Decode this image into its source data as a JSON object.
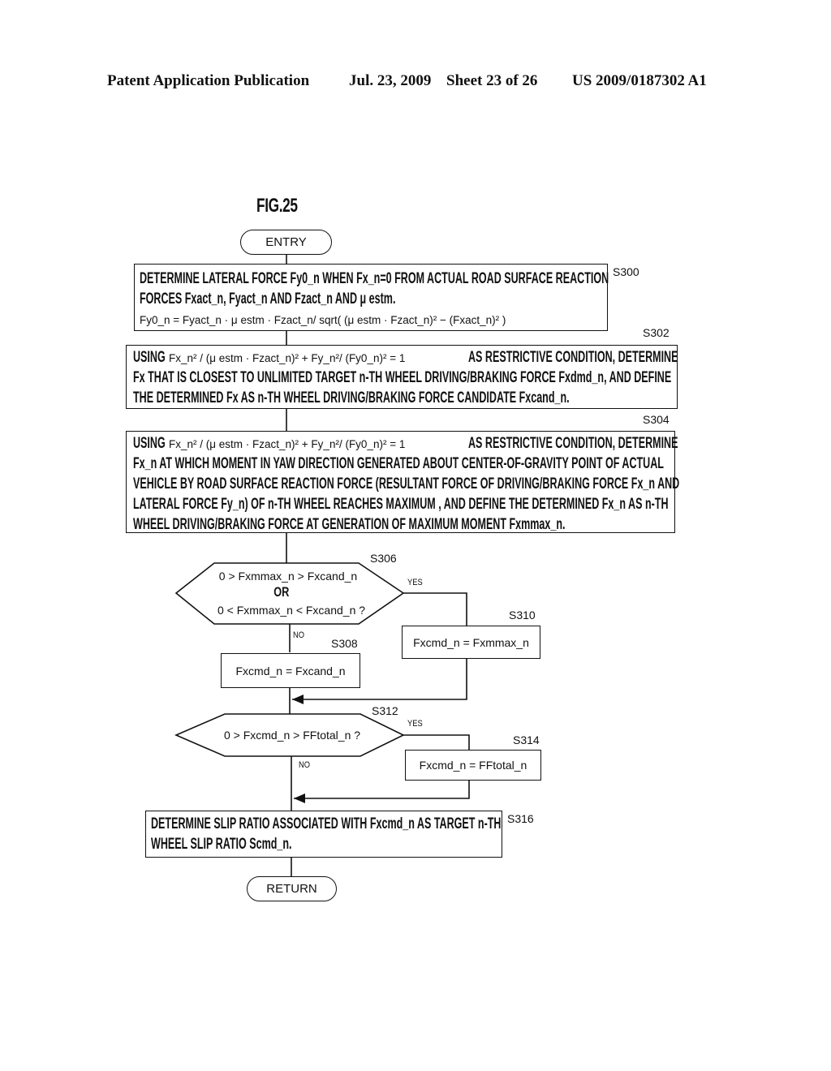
{
  "header": {
    "left": "Patent Application Publication",
    "date": "Jul. 23, 2009",
    "sheet": "Sheet 23 of 26",
    "pub_number": "US 2009/0187302 A1"
  },
  "figure": {
    "title": "FIG.25",
    "entry": "ENTRY",
    "return": "RETURN",
    "steps": {
      "s300": {
        "id": "S300",
        "line1": "DETERMINE LATERAL FORCE Fy0_n WHEN Fx_n=0 FROM ACTUAL ROAD SURFACE REACTION",
        "line2": "FORCES Fxact_n, Fyact_n AND Fzact_n AND μ estm.",
        "formula": "Fy0_n = Fyact_n · μ estm · Fzact_n/ sqrt( (μ estm ·  Fzact_n)² − (Fxact_n)² )"
      },
      "s302": {
        "id": "S302",
        "using": "USING",
        "formula": "Fx_n²  / (μ estm · Fzact_n)² + Fy_n²/ (Fy0_n)² = 1",
        "line1_rest": "AS RESTRICTIVE CONDITION, DETERMINE",
        "line2": "Fx THAT IS CLOSEST TO UNLIMITED TARGET n-TH WHEEL DRIVING/BRAKING FORCE Fxdmd_n, AND DEFINE",
        "line3": "THE DETERMINED Fx AS n-TH WHEEL DRIVING/BRAKING FORCE CANDIDATE Fxcand_n."
      },
      "s304": {
        "id": "S304",
        "using": "USING",
        "formula": "Fx_n²  / (μ estm · Fzact_n)² + Fy_n²/ (Fy0_n)² = 1",
        "line1_rest": "AS RESTRICTIVE CONDITION, DETERMINE",
        "line2": "Fx_n AT WHICH MOMENT IN YAW DIRECTION GENERATED ABOUT CENTER-OF-GRAVITY POINT OF ACTUAL",
        "line3": "VEHICLE BY ROAD SURFACE REACTION FORCE (RESULTANT FORCE OF DRIVING/BRAKING FORCE Fx_n AND",
        "line4": "LATERAL FORCE Fy_n) OF n-TH WHEEL REACHES MAXIMUM , AND DEFINE THE DETERMINED Fx_n AS n-TH",
        "line5": "WHEEL DRIVING/BRAKING FORCE AT GENERATION OF MAXIMUM MOMENT Fxmmax_n."
      },
      "s306": {
        "id": "S306",
        "line1": "0 > Fxmmax_n > Fxcand_n",
        "or": "OR",
        "line2": "0 < Fxmmax_n < Fxcand_n ?",
        "yes": "YES",
        "no": "NO"
      },
      "s308": {
        "id": "S308",
        "text": "Fxcmd_n = Fxcand_n"
      },
      "s310": {
        "id": "S310",
        "text": "Fxcmd_n = Fxmmax_n"
      },
      "s312": {
        "id": "S312",
        "text": "0 > Fxcmd_n > FFtotal_n ?",
        "yes": "YES",
        "no": "NO"
      },
      "s314": {
        "id": "S314",
        "text": "Fxcmd_n = FFtotal_n"
      },
      "s316": {
        "id": "S316",
        "line1": "DETERMINE SLIP RATIO ASSOCIATED WITH Fxcmd_n AS TARGET n-TH",
        "line2": "WHEEL SLIP RATIO Scmd_n."
      }
    }
  }
}
